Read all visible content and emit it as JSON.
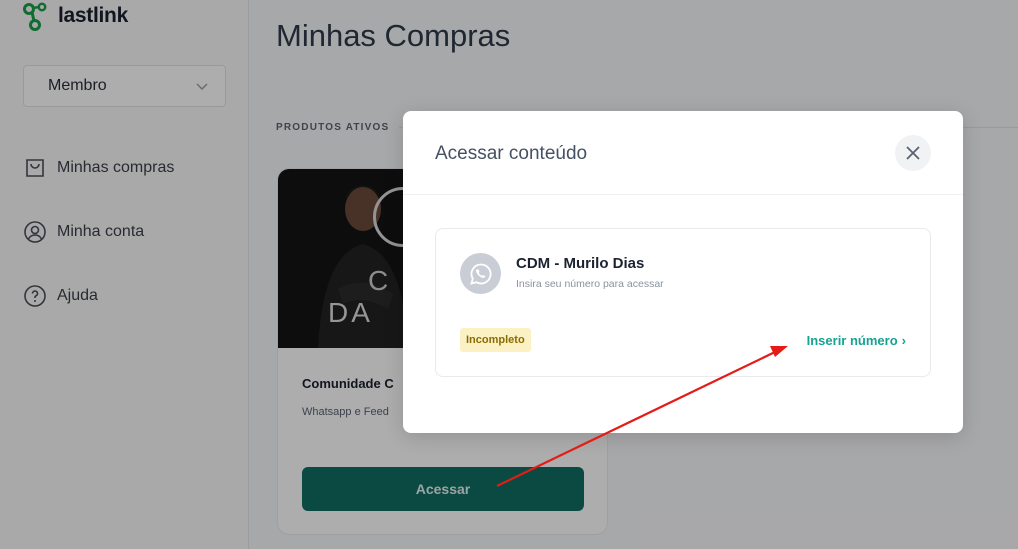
{
  "brand": {
    "name": "lastlink",
    "accent": "#1a9f4a"
  },
  "sidebar": {
    "role_select": {
      "value": "Membro"
    },
    "items": [
      {
        "label": "Minhas compras",
        "icon": "shopping-bag-icon"
      },
      {
        "label": "Minha conta",
        "icon": "user-circle-icon"
      },
      {
        "label": "Ajuda",
        "icon": "help-circle-icon"
      }
    ]
  },
  "main": {
    "title": "Minhas Compras",
    "section_label": "PRODUTOS ATIVOS",
    "product_card": {
      "thumb_text_line1": "C",
      "thumb_text_line2": "DA",
      "title": "Comunidade C",
      "description": "Whatsapp e Feed",
      "button_label": "Acessar",
      "button_color": "#0f6e63"
    }
  },
  "modal": {
    "title": "Acessar conteúdo",
    "item": {
      "name": "CDM - Murilo Dias",
      "subtitle": "Insira seu número para acessar",
      "icon": "whatsapp-icon",
      "status": "Incompleto",
      "status_color": "#fcf1c4",
      "action_label": "Inserir número",
      "action_suffix": "›",
      "action_color": "#17a292"
    }
  },
  "annotation": {
    "type": "arrow",
    "color": "#e41b17"
  }
}
